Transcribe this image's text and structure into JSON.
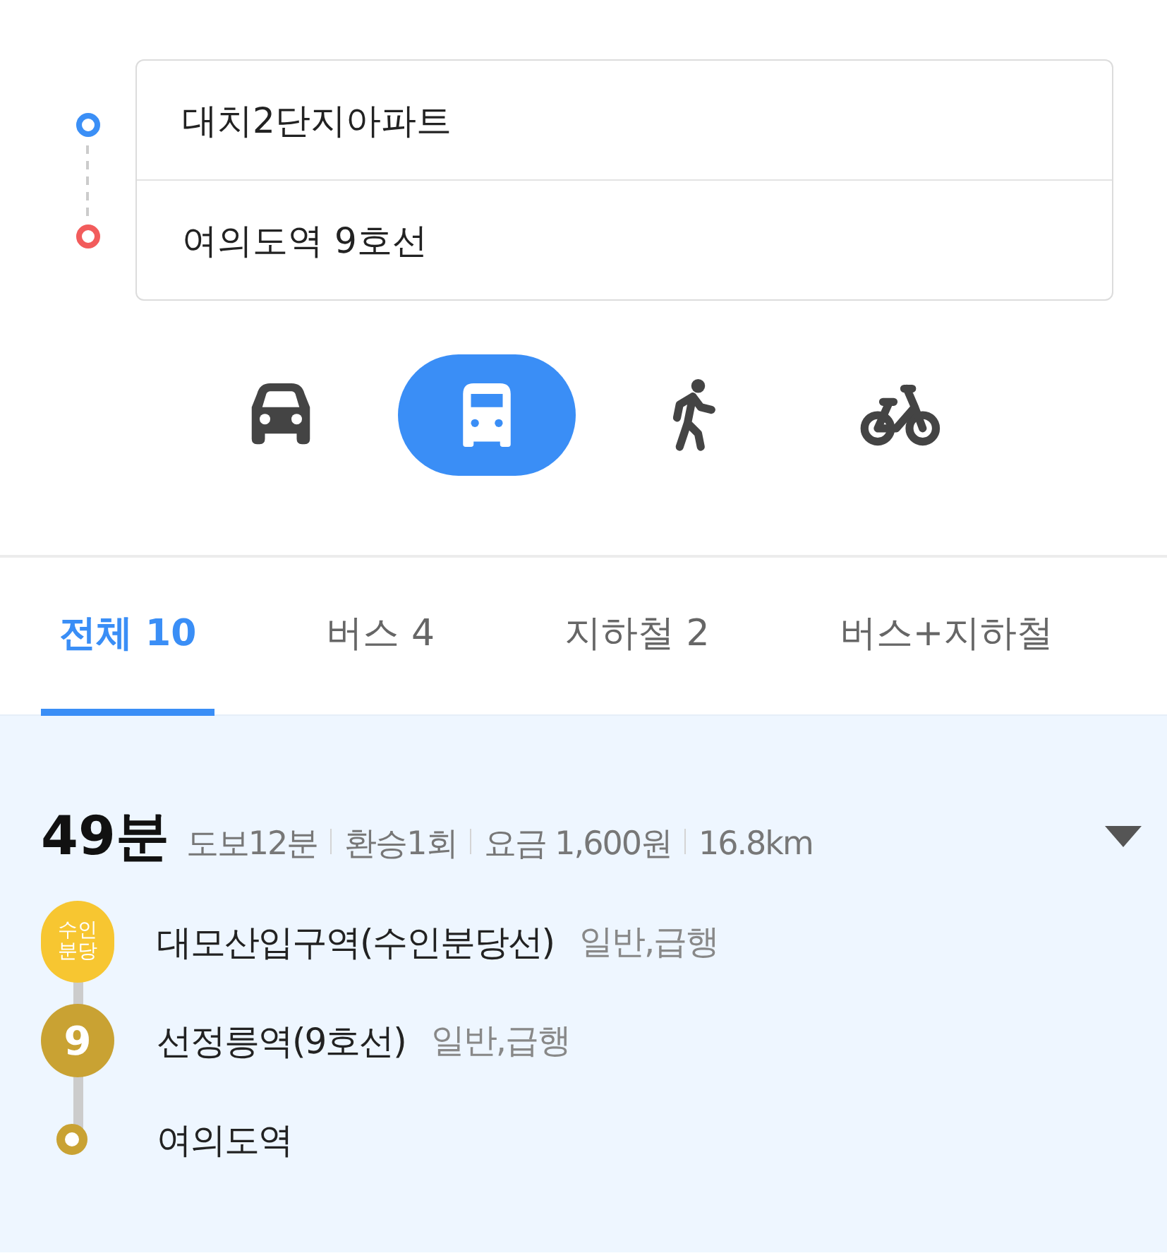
{
  "route": {
    "origin": "대치2단지아파트",
    "destination": "여의도역 9호선"
  },
  "modes": [
    {
      "kind": "car",
      "selected": false
    },
    {
      "kind": "bus",
      "selected": true
    },
    {
      "kind": "walk",
      "selected": false
    },
    {
      "kind": "bike",
      "selected": false
    }
  ],
  "tabs": [
    {
      "label": "전체 10",
      "selected": true
    },
    {
      "label": "버스 4",
      "selected": false
    },
    {
      "label": "지하철 2",
      "selected": false
    },
    {
      "label": "버스+지하철",
      "selected": false
    }
  ],
  "result": {
    "duration": "49분",
    "details": [
      "도보12분",
      "환승1회",
      "요금 1,600원",
      "16.8km"
    ],
    "steps": [
      {
        "kind": "line",
        "badge": "수인분당",
        "color": "#f7c631",
        "name": "대모산입구역(수인분당선)",
        "note": "일반,급행"
      },
      {
        "kind": "number",
        "badge": "9",
        "color": "#c9a233",
        "name": "선정릉역(9호선)",
        "note": "일반,급행"
      },
      {
        "kind": "end",
        "color": "#c9a233",
        "name": "여의도역"
      }
    ]
  }
}
